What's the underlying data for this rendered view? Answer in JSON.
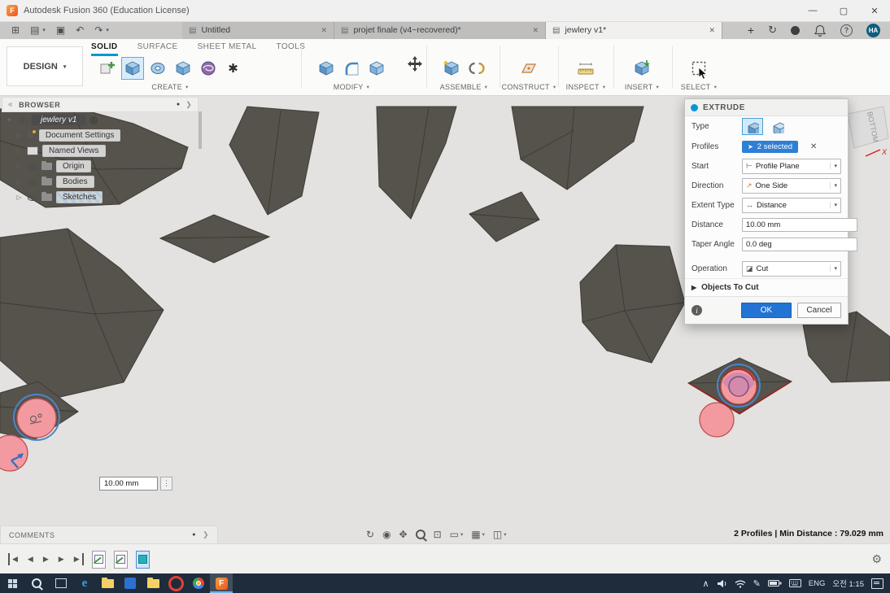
{
  "colors": {
    "accent_blue": "#0696d7",
    "selection_blue": "#4a90d9",
    "ok_blue": "#2273d4",
    "polygon_fill": "#56524c",
    "polygon_edge": "#403d38",
    "pink_fill": "#f29aa0",
    "pink_edge": "#b8423a",
    "taskbar_bg": "#1e2c3c"
  },
  "icons": {
    "caret": "▾",
    "close": "✕",
    "minimize": "—",
    "maximize": "▢",
    "plus": "+",
    "collapse": "«",
    "dot": "●",
    "target": "◎",
    "kebab": "⋮",
    "expander": "▷",
    "expander_open": "▼",
    "gear": "⚙",
    "undo": "↶",
    "redo": "↷",
    "app_grid": "⊞",
    "save": "▣",
    "file_menu": "▤",
    "doc": "▤",
    "help": "?",
    "sync": "↻",
    "prev": "◀",
    "next": "▶",
    "panel_handle": "❯",
    "info": "i",
    "pen": "✎",
    "chevron_up": "∧",
    "thread": "✱",
    "orbit": "↻",
    "look_at": "◉",
    "pan": "✥",
    "fit": "⊡",
    "display": "▭",
    "grid_snap": "▦",
    "viewports": "◫",
    "cursor": "➤",
    "profile_plane": "⊢",
    "one_side": "↗",
    "distance": "↔",
    "cut": "◪",
    "fusion_logo": "F",
    "edge_logo": "e"
  },
  "title_bar": {
    "title": "Autodesk Fusion 360 (Education License)"
  },
  "doc_tabs": [
    {
      "label": "Untitled"
    },
    {
      "label": "projet finale (v4~recovered)*"
    },
    {
      "label": "jewlery v1*"
    }
  ],
  "account": {
    "initials": "HA"
  },
  "ribbon": {
    "design_label": "DESIGN",
    "tabs": [
      {
        "label": "SOLID"
      },
      {
        "label": "SURFACE"
      },
      {
        "label": "SHEET METAL"
      },
      {
        "label": "TOOLS"
      }
    ],
    "groups": [
      {
        "label": "CREATE"
      },
      {
        "label": "MODIFY"
      },
      {
        "label": "ASSEMBLE"
      },
      {
        "label": "CONSTRUCT"
      },
      {
        "label": "INSPECT"
      },
      {
        "label": "INSERT"
      },
      {
        "label": "SELECT"
      }
    ]
  },
  "browser": {
    "header": "BROWSER",
    "root_label": "jewlery v1",
    "items": [
      {
        "label": "Document Settings"
      },
      {
        "label": "Named Views"
      },
      {
        "label": "Origin"
      },
      {
        "label": "Bodies"
      },
      {
        "label": "Sketches"
      }
    ]
  },
  "extrude_dialog": {
    "title": "EXTRUDE",
    "type_label": "Type",
    "profiles_label": "Profiles",
    "profiles_value": "2 selected",
    "start_label": "Start",
    "start_value": "Profile Plane",
    "direction_label": "Direction",
    "direction_value": "One Side",
    "extent_label": "Extent Type",
    "extent_value": "Distance",
    "distance_label": "Distance",
    "distance_value": "10.00 mm",
    "taper_label": "Taper Angle",
    "taper_value": "0.0 deg",
    "operation_label": "Operation",
    "operation_value": "Cut",
    "objects_label": "Objects To Cut",
    "ok_label": "OK",
    "cancel_label": "Cancel"
  },
  "canvas": {
    "dimension_value": "10.00 mm",
    "viewcube_label": "BOTTOM",
    "axis_x_label": "X"
  },
  "bottom": {
    "comments_label": "COMMENTS",
    "status_text": "2 Profiles | Min Distance : 79.029 mm"
  },
  "taskbar": {
    "language": "ENG",
    "time": "오전 1:15"
  }
}
